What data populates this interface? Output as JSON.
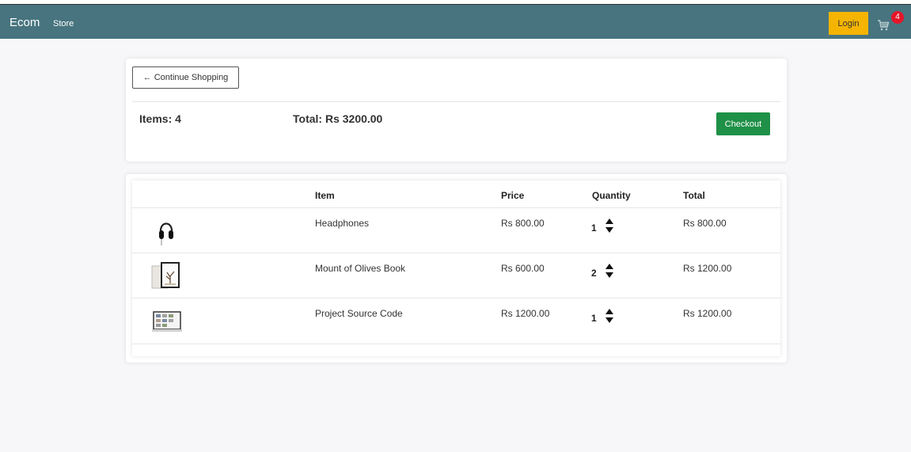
{
  "navbar": {
    "brand": "Ecom",
    "links": [
      "Store"
    ],
    "login_label": "Login",
    "cart_count": "4",
    "colors": {
      "bar": "#47747f",
      "login": "#f5b400",
      "badge": "#e4162a"
    }
  },
  "summary": {
    "continue_label": "← Continue Shopping",
    "items_label": "Items: 4",
    "total_label": "Total: Rs 3200.00",
    "checkout_label": "Checkout",
    "checkout_color": "#1f9047"
  },
  "cart": {
    "headers": {
      "item": "Item",
      "price": "Price",
      "quantity": "Quantity",
      "total": "Total"
    },
    "rows": [
      {
        "name": "Headphones",
        "price": "Rs 800.00",
        "quantity": "1",
        "total": "Rs 800.00",
        "icon": "headphones-image"
      },
      {
        "name": "Mount of Olives Book",
        "price": "Rs 600.00",
        "quantity": "2",
        "total": "Rs 1200.00",
        "icon": "book-image"
      },
      {
        "name": "Project Source Code",
        "price": "Rs 1200.00",
        "quantity": "1",
        "total": "Rs 1200.00",
        "icon": "source-code-image"
      }
    ]
  }
}
